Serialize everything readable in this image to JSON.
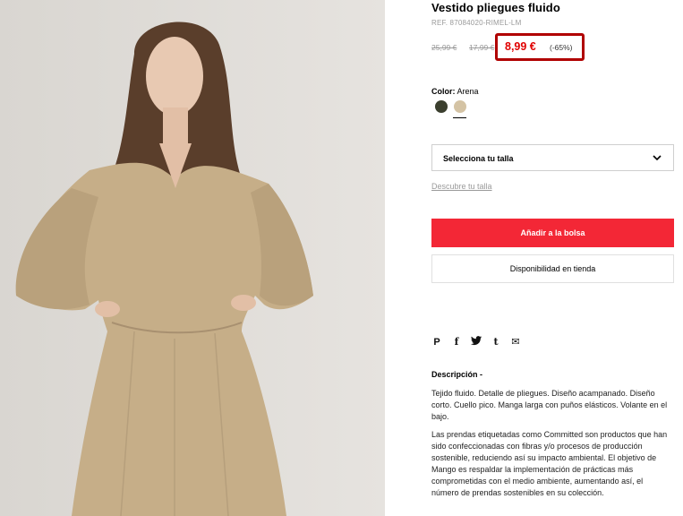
{
  "product": {
    "title": "Vestido pliegues fluido",
    "reference": "REF. 87084020-RIMEL-LM",
    "old_price_1": "25,99 €",
    "old_price_2": "17,99 €",
    "current_price": "8,99 €",
    "discount": "(-65%)",
    "price_color": "#e00000"
  },
  "color": {
    "label": "Color:",
    "value": "Arena",
    "swatches": [
      "#3b3f2e",
      "#d4c3a4"
    ]
  },
  "size": {
    "select_label": "Selecciona tu talla",
    "guide_link": "Descubre tu talla"
  },
  "actions": {
    "add_to_bag": "Añadir a la bolsa",
    "store_availability": "Disponibilidad en tienda",
    "accent": "#f32736"
  },
  "share": {
    "icons": [
      "pinterest-icon",
      "facebook-icon",
      "twitter-icon",
      "tumblr-icon",
      "email-icon"
    ],
    "glyphs": [
      "P",
      "f",
      "🐦",
      "t",
      "✉"
    ]
  },
  "description": {
    "title": "Descripción -",
    "paragraph_1": "Tejido fluido. Detalle de pliegues. Diseño acampanado. Diseño corto. Cuello pico. Manga larga con puños elásticos. Volante en el bajo.",
    "paragraph_2": "Las prendas etiquetadas como Committed son productos que han sido confeccionadas con fibras y/o procesos de producción sostenible, reduciendo así su impacto ambiental. El objetivo de Mango es respaldar la implementación de prácticas más comprometidas con el medio ambiente, aumentando así, el número de prendas sostenibles en su colección."
  }
}
